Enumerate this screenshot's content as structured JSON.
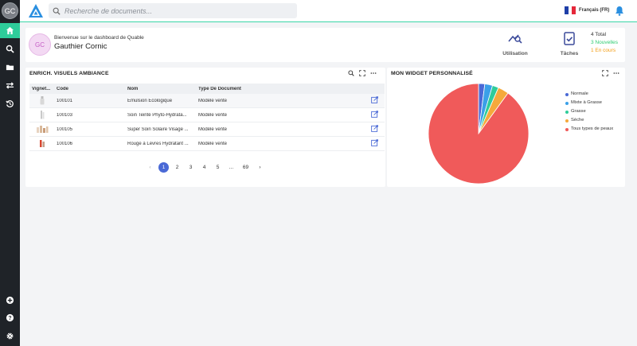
{
  "sidebar": {
    "user_initials": "GC",
    "items": [
      {
        "icon": "home-icon",
        "active": true
      },
      {
        "icon": "search-icon",
        "active": false
      },
      {
        "icon": "folder-icon",
        "active": false
      },
      {
        "icon": "transfer-icon",
        "active": false
      },
      {
        "icon": "history-icon",
        "active": false
      }
    ],
    "bottom_items": [
      {
        "icon": "add-circle-icon"
      },
      {
        "icon": "help-icon"
      },
      {
        "icon": "settings-icon"
      }
    ]
  },
  "topbar": {
    "search_placeholder": "Recherche de documents...",
    "language": "Français (FR)"
  },
  "welcome": {
    "initials": "GC",
    "greeting": "Bienvenue sur le dashboard de Quable",
    "user_name": "Gauthier Cornic",
    "usage_label": "Utilisation",
    "tasks_label": "Tâches",
    "tasks_total": "4 Total",
    "tasks_new": "3 Nouvelles",
    "tasks_in_progress": "1 En cours"
  },
  "table_widget": {
    "title": "ENRICH. VISUELS AMBIANCE",
    "columns": [
      "Vignet...",
      "Code",
      "Nom",
      "Type De Document"
    ],
    "rows": [
      {
        "code": "100101",
        "name": "Émulsion Écologique",
        "type": "Modèle vente"
      },
      {
        "code": "100103",
        "name": "Soin Teinté Phyto-Hydrata...",
        "type": "Modèle vente"
      },
      {
        "code": "100105",
        "name": "Super Soin Solaire Visage ...",
        "type": "Modèle vente"
      },
      {
        "code": "100106",
        "name": "Rouge à Lèvres Hydratant ...",
        "type": "Modèle vente"
      }
    ],
    "pagination": {
      "current": "1",
      "pages": [
        "1",
        "2",
        "3",
        "4",
        "5",
        "...",
        "69"
      ],
      "prev": "‹",
      "next": "›"
    }
  },
  "pie_widget": {
    "title": "MON WIDGET PERSONNALISÉ",
    "legend": [
      {
        "label": "Normale",
        "color": "#4a69d6"
      },
      {
        "label": "Mixte à Grasse",
        "color": "#3aa0e8"
      },
      {
        "label": "Grasse",
        "color": "#2ecc9a"
      },
      {
        "label": "Sèche",
        "color": "#f5a93b"
      },
      {
        "label": "Tous types de peaux",
        "color": "#f05a5a"
      }
    ]
  },
  "chart_data": {
    "type": "pie",
    "categories": [
      "Normale",
      "Mixte à Grasse",
      "Grasse",
      "Sèche",
      "Tous types de peaux"
    ],
    "values": [
      2,
      2.5,
      2,
      3.5,
      90
    ]
  },
  "colors": {
    "accent": "#2ecc9a",
    "primary": "#4a69d6",
    "sidebar": "#1f2328"
  }
}
